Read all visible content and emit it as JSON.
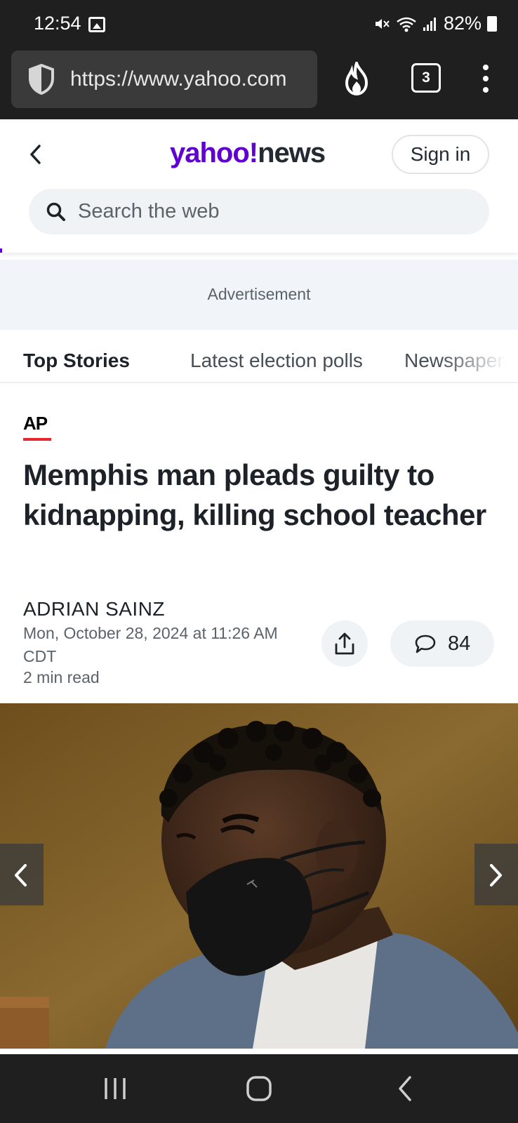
{
  "status_bar": {
    "time": "12:54",
    "battery": "82%"
  },
  "browser": {
    "url": "https://www.yahoo.com",
    "tab_count": "3"
  },
  "header": {
    "logo_yahoo": "yahoo",
    "logo_bang": "!",
    "logo_news": "news",
    "sign_in_label": "Sign in",
    "search_placeholder": "Search the web"
  },
  "ad": {
    "label": "Advertisement"
  },
  "nav_tabs": [
    {
      "label": "Top Stories",
      "active": true
    },
    {
      "label": "Latest election polls",
      "active": false
    },
    {
      "label": "Newspapers",
      "active": false
    }
  ],
  "article": {
    "source": "AP",
    "headline": "Memphis man pleads guilty to kidnapping, killing school teacher",
    "author": "ADRIAN SAINZ",
    "date": "Mon, October 28, 2024 at 11:26 AM CDT",
    "read_time": "2 min read",
    "comment_count": "84"
  },
  "colors": {
    "brand": "#6001d2",
    "ap_red": "#e8262d",
    "system_bar": "#1f1f1f"
  }
}
